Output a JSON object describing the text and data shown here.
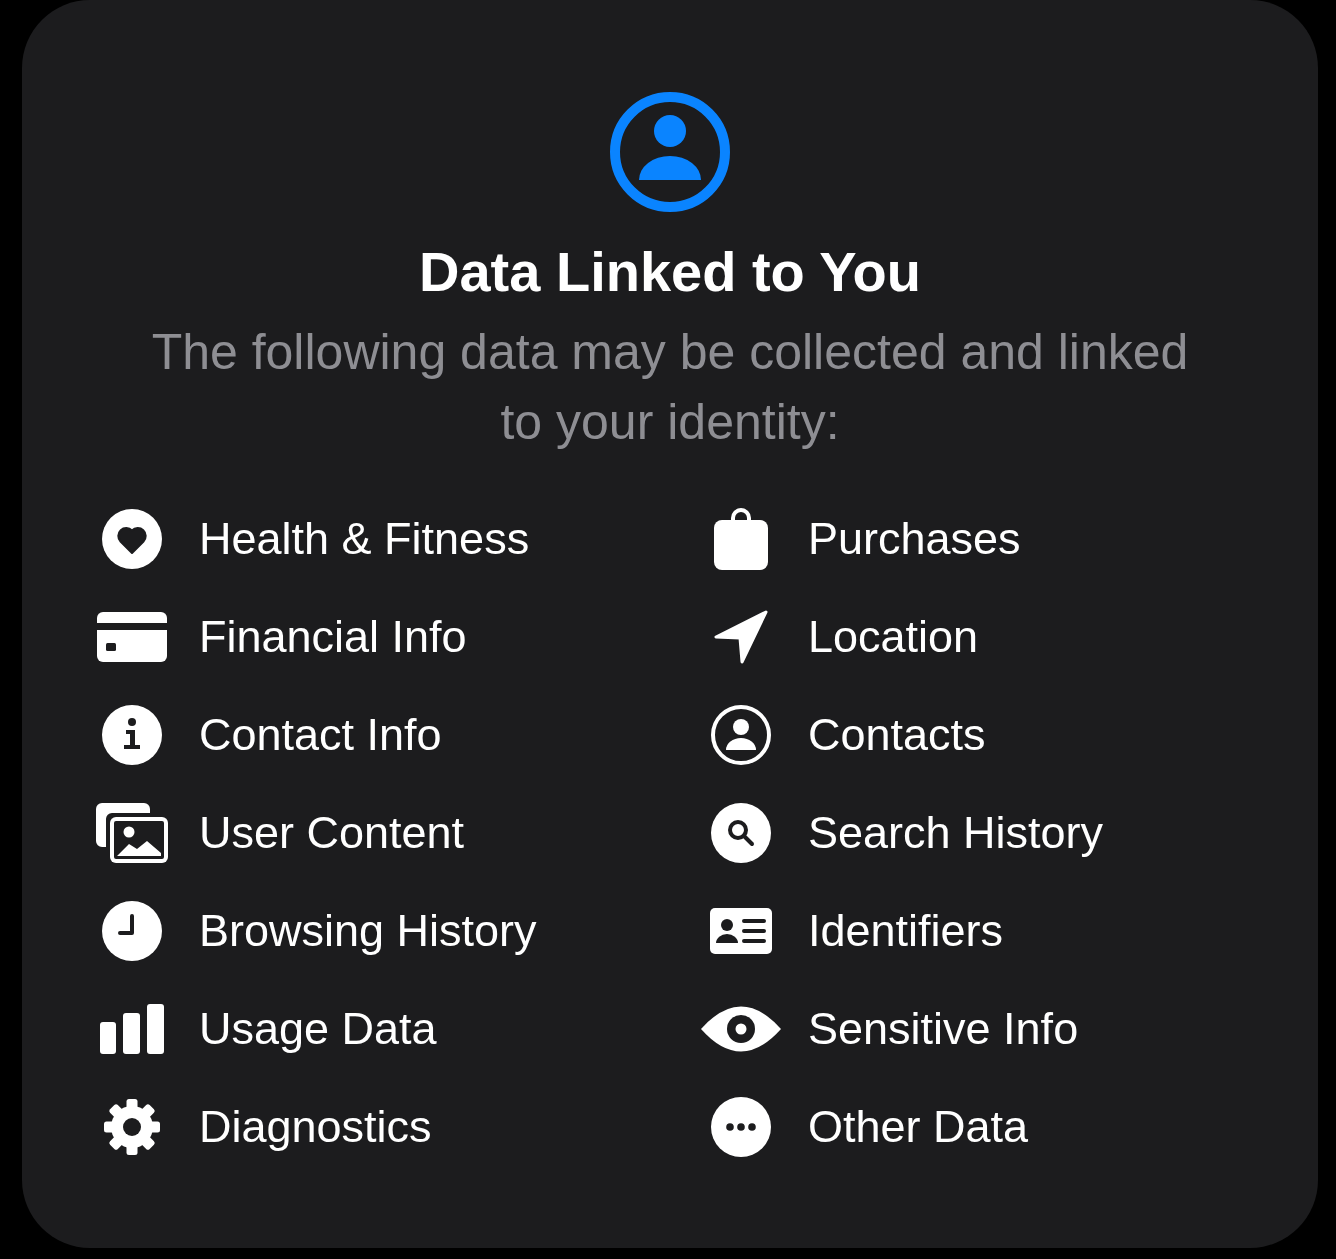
{
  "header": {
    "title": "Data Linked to You",
    "description": "The following data may be collected and linked to your identity:"
  },
  "categories": [
    {
      "label": "Health & Fitness"
    },
    {
      "label": "Purchases"
    },
    {
      "label": "Financial Info"
    },
    {
      "label": "Location"
    },
    {
      "label": "Contact Info"
    },
    {
      "label": "Contacts"
    },
    {
      "label": "User Content"
    },
    {
      "label": "Search History"
    },
    {
      "label": "Browsing History"
    },
    {
      "label": "Identifiers"
    },
    {
      "label": "Usage Data"
    },
    {
      "label": "Sensitive Info"
    },
    {
      "label": "Diagnostics"
    },
    {
      "label": "Other Data"
    }
  ]
}
